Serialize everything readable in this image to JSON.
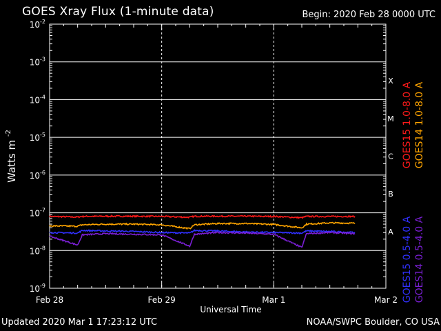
{
  "header": {
    "title": "GOES Xray Flux (1-minute data)",
    "begin": "Begin:  2020 Feb 28 0000 UTC"
  },
  "footer": {
    "updated": "Updated 2020 Mar  1 17:23:12 UTC",
    "credit": "NOAA/SWPC Boulder, CO USA"
  },
  "colors": {
    "background": "#000000",
    "goes15_long": "#ff1a1a",
    "goes14_long": "#ffa500",
    "goes15_short": "#3030ff",
    "goes14_short": "#7b1fd6"
  },
  "chart_data": {
    "type": "line",
    "title": "GOES Xray Flux (1-minute data)",
    "xlabel": "Universal Time",
    "ylabel": "Watts m",
    "ylabel_superscript": "-2",
    "yscale": "log",
    "ylim": [
      1e-09,
      0.01
    ],
    "xlim_days": [
      0,
      3
    ],
    "x_tick_labels": [
      "Feb 28",
      "Feb 29",
      "Mar 1",
      "Mar 2"
    ],
    "y_tick_labels": [
      {
        "base": "10",
        "exp": "-9"
      },
      {
        "base": "10",
        "exp": "-8"
      },
      {
        "base": "10",
        "exp": "-7"
      },
      {
        "base": "10",
        "exp": "-6"
      },
      {
        "base": "10",
        "exp": "-5"
      },
      {
        "base": "10",
        "exp": "-4"
      },
      {
        "base": "10",
        "exp": "-3"
      },
      {
        "base": "10",
        "exp": "-2"
      }
    ],
    "flare_classes": [
      "A",
      "B",
      "C",
      "M",
      "X"
    ],
    "grid": true,
    "legend": [
      "GOES15 1.0-8.0 A",
      "GOES14 1.0-8.0 A",
      "GOES15 0.5-4.0 A",
      "GOES14 0.5-4.0 A"
    ],
    "x_dates": [
      "2020-02-28 00:00",
      "2020-02-28 06:00",
      "2020-02-28 07:00",
      "2020-02-28 12:00",
      "2020-02-28 18:00",
      "2020-02-29 00:00",
      "2020-02-29 06:00",
      "2020-02-29 07:00",
      "2020-02-29 12:00",
      "2020-02-29 18:00",
      "2020-03-01 00:00",
      "2020-03-01 06:00",
      "2020-03-01 07:00",
      "2020-03-01 12:00",
      "2020-03-01 17:23"
    ],
    "series": [
      {
        "name": "GOES15 1.0-8.0 A",
        "color": "#ff1a1a",
        "values": [
          8e-08,
          7.7e-08,
          8e-08,
          8.1e-08,
          8.1e-08,
          8e-08,
          7.6e-08,
          8.1e-08,
          8.1e-08,
          8.1e-08,
          8e-08,
          7.4e-08,
          8e-08,
          8e-08,
          8e-08
        ]
      },
      {
        "name": "GOES14 1.0-8.0 A",
        "color": "#ffa500",
        "values": [
          4.5e-08,
          4.4e-08,
          4.8e-08,
          5e-08,
          5e-08,
          4.8e-08,
          3.8e-08,
          4.8e-08,
          5.2e-08,
          5.2e-08,
          4.9e-08,
          4e-08,
          5e-08,
          5.4e-08,
          5.3e-08
        ]
      },
      {
        "name": "GOES15 0.5-4.0 A",
        "color": "#3030ff",
        "values": [
          3e-08,
          2.9e-08,
          3.4e-08,
          3.3e-08,
          3.2e-08,
          3e-08,
          2.9e-08,
          3.4e-08,
          3.3e-08,
          3.1e-08,
          3e-08,
          2.9e-08,
          3.3e-08,
          3.2e-08,
          3e-08
        ]
      },
      {
        "name": "GOES14 0.5-4.0 A",
        "color": "#7b1fd6",
        "values": [
          2.4e-08,
          1.4e-08,
          2.6e-08,
          2.8e-08,
          2.7e-08,
          2.6e-08,
          1.3e-08,
          2.7e-08,
          3e-08,
          2.9e-08,
          2.7e-08,
          1.2e-08,
          2.8e-08,
          3e-08,
          2.8e-08
        ]
      }
    ]
  }
}
